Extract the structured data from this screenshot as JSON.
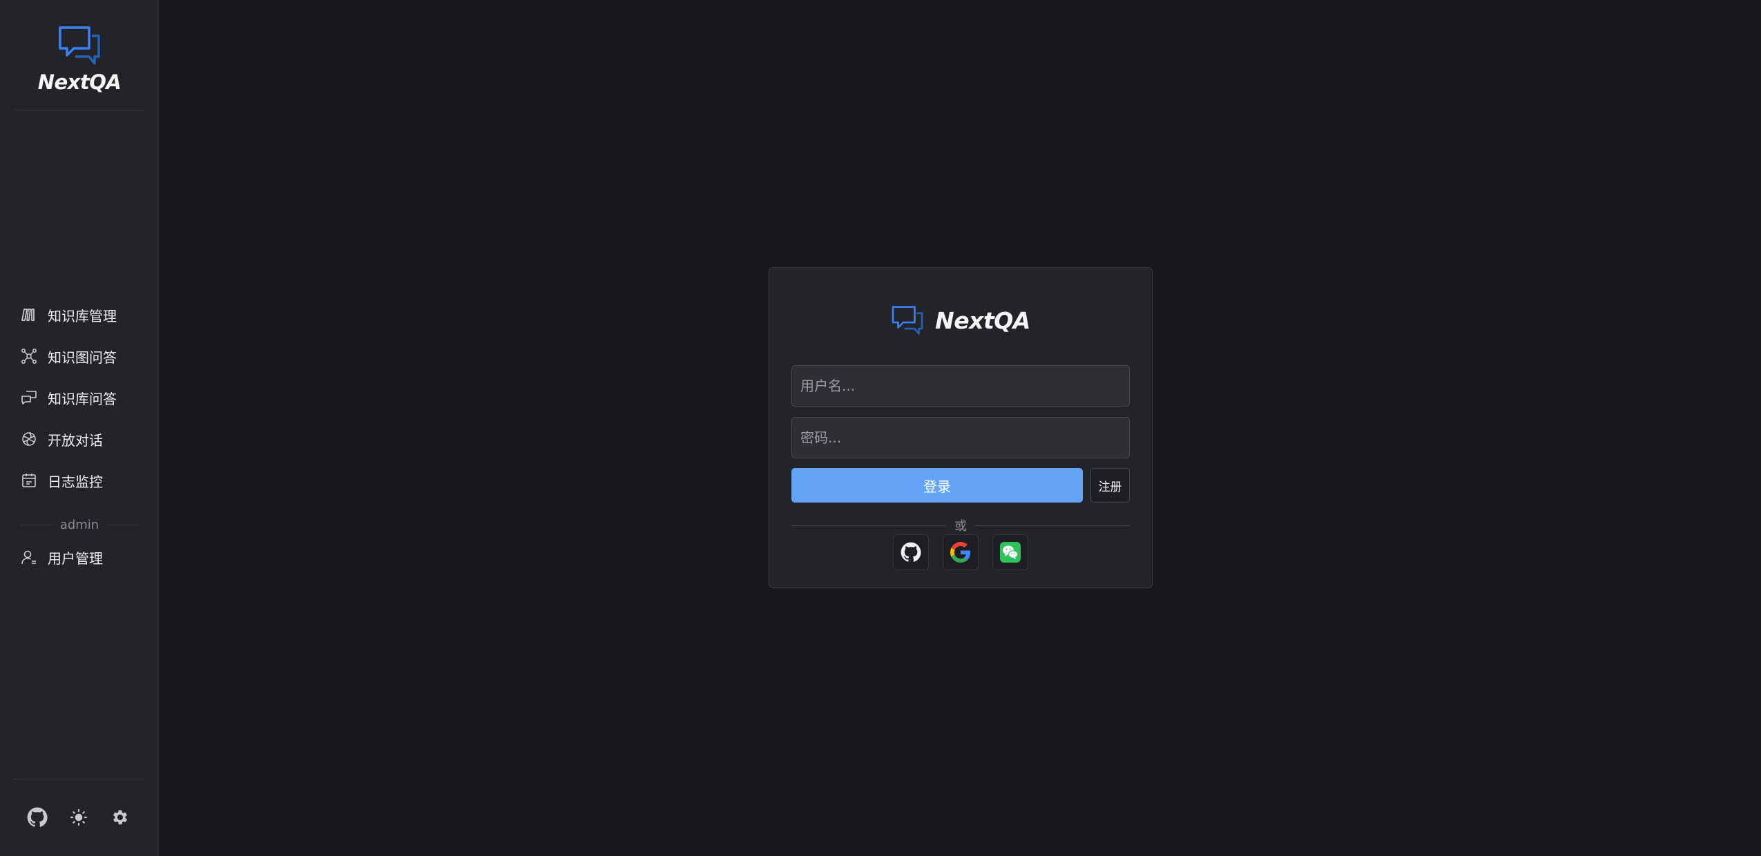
{
  "app": {
    "name": "NextQA"
  },
  "sidebar": {
    "items": [
      {
        "label": "知识库管理",
        "icon": "library-icon"
      },
      {
        "label": "知识图问答",
        "icon": "graph-icon"
      },
      {
        "label": "知识库问答",
        "icon": "chat-bubbles-icon"
      },
      {
        "label": "开放对话",
        "icon": "openai-icon"
      },
      {
        "label": "日志监控",
        "icon": "calendar-log-icon"
      }
    ],
    "section_label": "admin",
    "admin_items": [
      {
        "label": "用户管理",
        "icon": "user-manage-icon"
      }
    ],
    "footer_icons": [
      "github-icon",
      "sun-icon",
      "gear-icon"
    ]
  },
  "login": {
    "brand": "NextQA",
    "username_placeholder": "用户名...",
    "password_placeholder": "密码...",
    "login_label": "登录",
    "register_label": "注册",
    "or_label": "或",
    "social": [
      "github-icon",
      "google-icon",
      "wechat-icon"
    ]
  },
  "colors": {
    "background": "#18181c",
    "sidebar": "#232429",
    "primary_button": "#64a4f6",
    "brand_icon": "#3b82f6",
    "wechat": "#2fc25b"
  }
}
